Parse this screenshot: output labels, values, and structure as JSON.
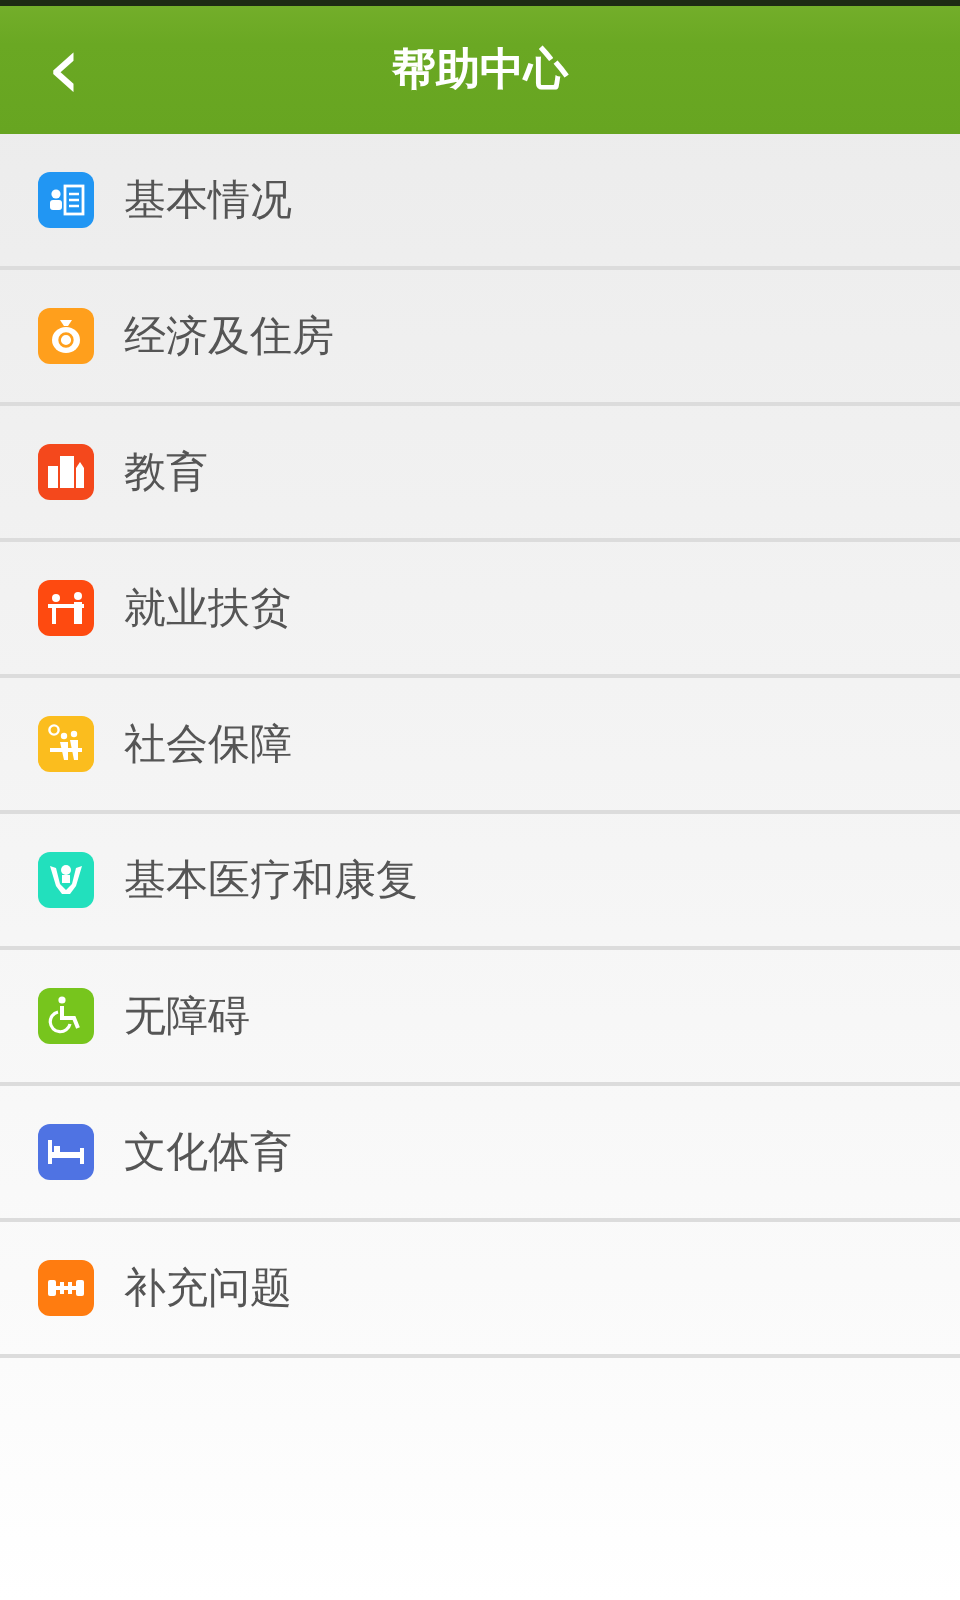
{
  "header": {
    "back": "‹",
    "title": "帮助中心"
  },
  "items": [
    {
      "label": "基本情况",
      "color": "#2196f3"
    },
    {
      "label": "经济及住房",
      "color": "#ff9f1c"
    },
    {
      "label": "教育",
      "color": "#f4481c"
    },
    {
      "label": "就业扶贫",
      "color": "#fe4a10"
    },
    {
      "label": "社会保障",
      "color": "#fbbd1e"
    },
    {
      "label": "基本医疗和康复",
      "color": "#22e0bd"
    },
    {
      "label": "无障碍",
      "color": "#77c51d"
    },
    {
      "label": "文化体育",
      "color": "#4f73e3"
    },
    {
      "label": "补充问题",
      "color": "#ff7c10"
    }
  ]
}
